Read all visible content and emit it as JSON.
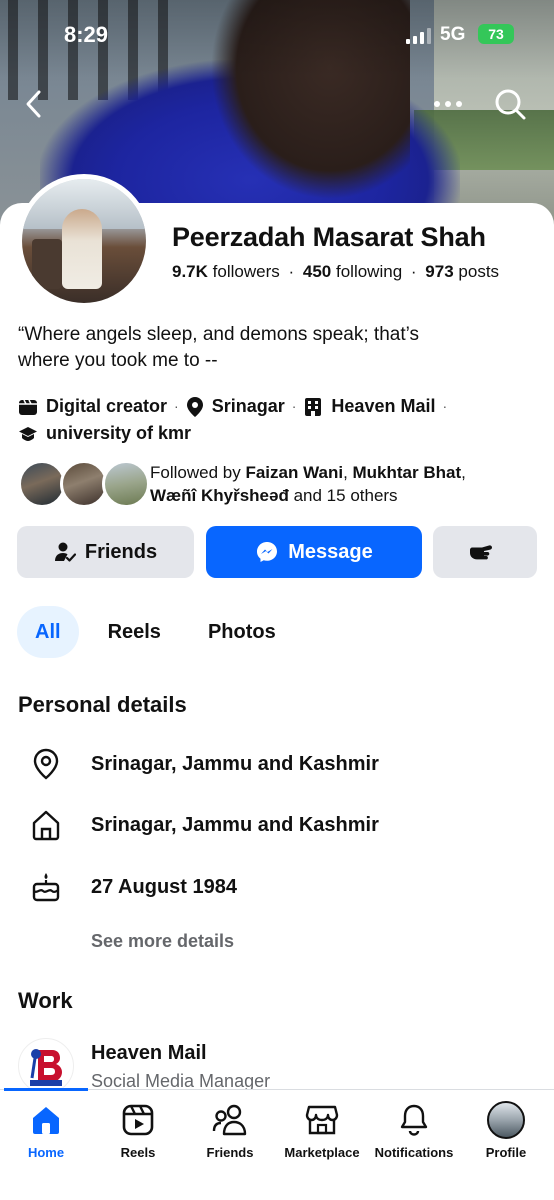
{
  "status_bar": {
    "time": "8:29",
    "network": "5G",
    "battery": "73"
  },
  "profile": {
    "name": "Peerzadah Masarat Shah",
    "followers_count": "9.7K",
    "followers_label": "followers",
    "following_count": "450",
    "following_label": "following",
    "posts_count": "973",
    "posts_label": "posts",
    "bio_line1": "“Where angels sleep, and demons speak; that’s",
    "bio_line2": "where you took me to --",
    "category": "Digital creator",
    "location": "Srinagar",
    "workplace": "Heaven Mail",
    "education": "university of kmr"
  },
  "followed_by": {
    "prefix": "Followed by",
    "name1": "Faizan Wani",
    "name2": "Mukhtar Bhat",
    "name3": "Wæñî Khyřsheəđ",
    "suffix": "and 15 others"
  },
  "actions": {
    "friends_label": "Friends",
    "message_label": "Message"
  },
  "tabs": [
    {
      "label": "All"
    },
    {
      "label": "Reels"
    },
    {
      "label": "Photos"
    }
  ],
  "personal_details": {
    "title": "Personal details",
    "current_city": "Srinagar, Jammu and Kashmir",
    "hometown": "Srinagar, Jammu and Kashmir",
    "birthday": "27 August 1984",
    "see_more": "See more details"
  },
  "work": {
    "title": "Work",
    "company": "Heaven Mail",
    "role": "Social Media Manager"
  },
  "bottom_nav": [
    {
      "label": "Home",
      "icon": "home-icon"
    },
    {
      "label": "Reels",
      "icon": "reels-icon"
    },
    {
      "label": "Friends",
      "icon": "friends-icon"
    },
    {
      "label": "Marketplace",
      "icon": "marketplace-icon"
    },
    {
      "label": "Notifications",
      "icon": "bell-icon"
    },
    {
      "label": "Profile",
      "icon": "profile-avatar"
    }
  ],
  "colors": {
    "accent": "#0866ff",
    "button_gray": "#e4e6eb",
    "battery": "#34c759"
  }
}
